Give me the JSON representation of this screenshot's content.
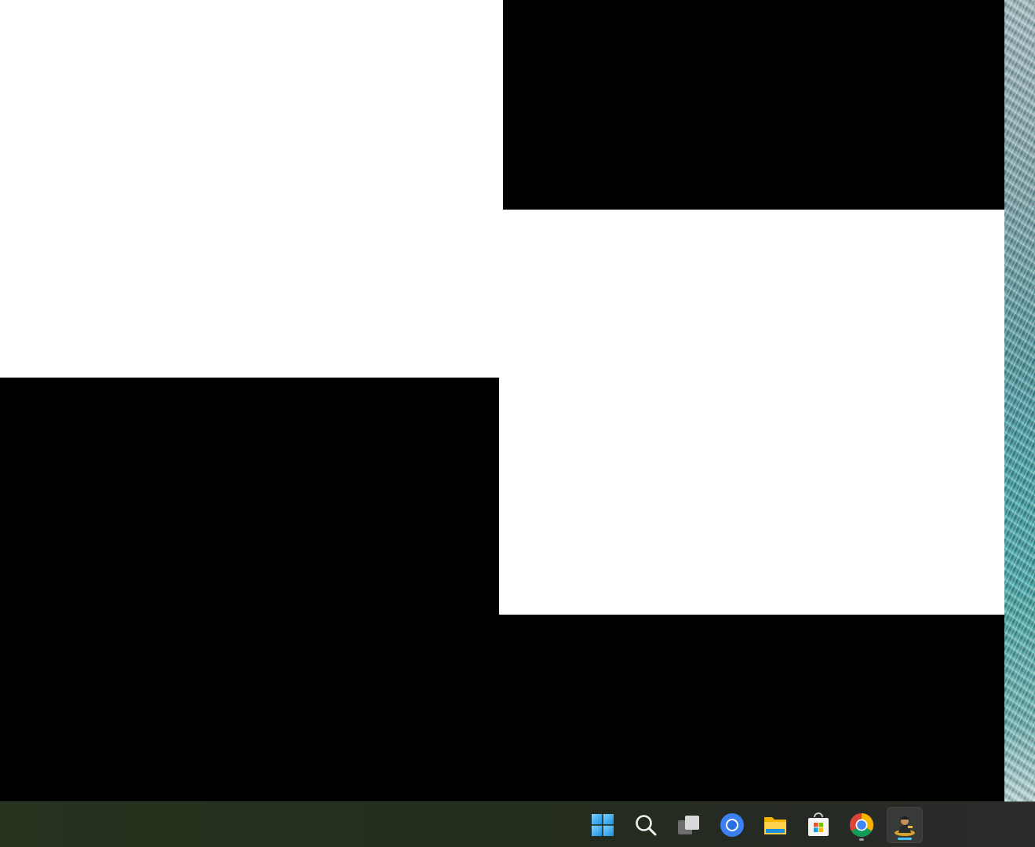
{
  "screen": {
    "wallpaper": "ocean-wallpaper"
  },
  "windows": [
    {
      "name": "white-window-top-left",
      "color": "#ffffff"
    },
    {
      "name": "black-window-top-right",
      "color": "#000000"
    },
    {
      "name": "white-window-middle-right",
      "color": "#ffffff"
    },
    {
      "name": "black-window-bottom",
      "color": "#000000"
    }
  ],
  "taskbar": {
    "items": [
      {
        "icon": "windows-start-icon",
        "running": false,
        "active": false
      },
      {
        "icon": "search-icon",
        "running": false,
        "active": false
      },
      {
        "icon": "task-view-icon",
        "running": false,
        "active": false
      },
      {
        "icon": "chromium-icon",
        "running": false,
        "active": false
      },
      {
        "icon": "file-explorer-icon",
        "running": false,
        "active": false
      },
      {
        "icon": "microsoft-store-icon",
        "running": false,
        "active": false
      },
      {
        "icon": "chrome-icon",
        "running": true,
        "active": false
      },
      {
        "icon": "game-app-icon",
        "running": true,
        "active": true
      }
    ],
    "accent_color": "#4cc2ff"
  }
}
